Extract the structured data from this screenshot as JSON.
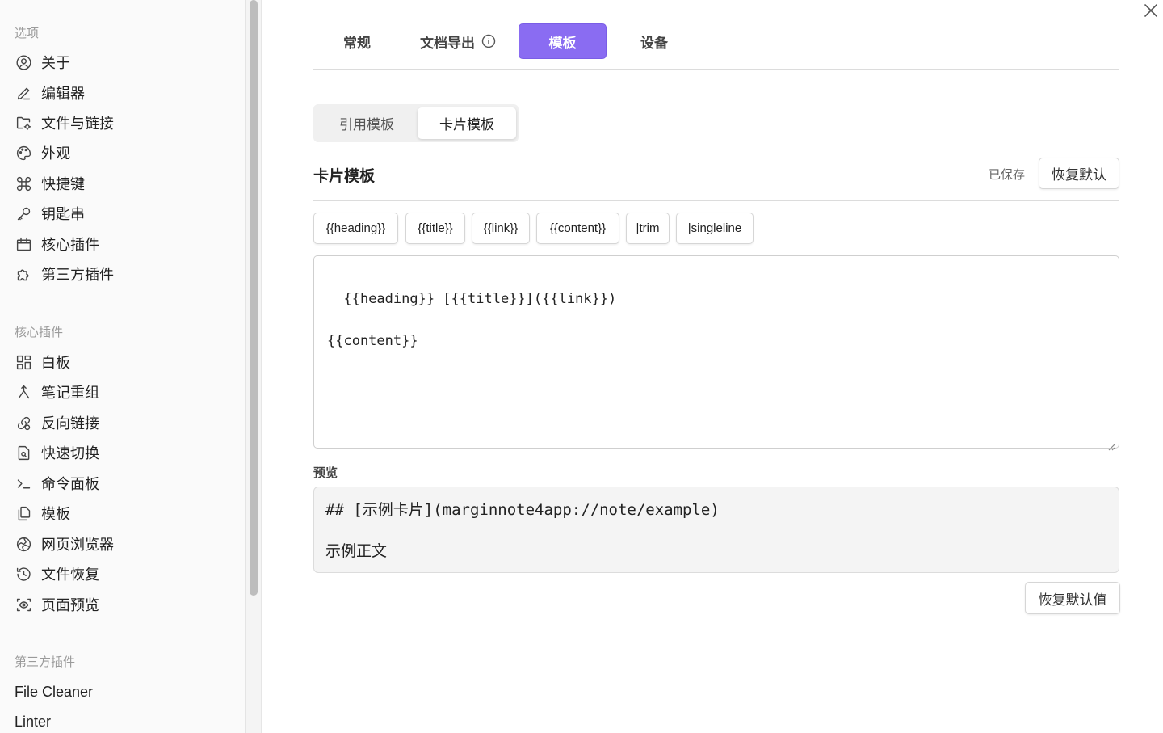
{
  "sidebar": {
    "sections": [
      {
        "title": "选项",
        "items": [
          {
            "label": "关于",
            "icon": "user-circle-icon"
          },
          {
            "label": "编辑器",
            "icon": "pencil-icon"
          },
          {
            "label": "文件与链接",
            "icon": "folder-cog-icon"
          },
          {
            "label": "外观",
            "icon": "palette-icon"
          },
          {
            "label": "快捷键",
            "icon": "command-icon"
          },
          {
            "label": "钥匙串",
            "icon": "key-icon"
          },
          {
            "label": "核心插件",
            "icon": "calendar-box-icon"
          },
          {
            "label": "第三方插件",
            "icon": "puzzle-icon"
          }
        ]
      },
      {
        "title": "核心插件",
        "items": [
          {
            "label": "白板",
            "icon": "layout-dashboard-icon"
          },
          {
            "label": "笔记重组",
            "icon": "merge-icon"
          },
          {
            "label": "反向链接",
            "icon": "link-refresh-icon"
          },
          {
            "label": "快速切换",
            "icon": "file-search-icon"
          },
          {
            "label": "命令面板",
            "icon": "terminal-icon"
          },
          {
            "label": "模板",
            "icon": "files-icon"
          },
          {
            "label": "网页浏览器",
            "icon": "globe-icon"
          },
          {
            "label": "文件恢复",
            "icon": "history-icon"
          },
          {
            "label": "页面预览",
            "icon": "eye-scan-icon"
          }
        ]
      },
      {
        "title": "第三方插件",
        "items": [
          {
            "label": "File Cleaner"
          },
          {
            "label": "Linter"
          }
        ]
      }
    ]
  },
  "tabs": {
    "items": [
      "常规",
      "文档导出",
      "模板",
      "设备"
    ],
    "active": "模板"
  },
  "subtabs": {
    "items": [
      "引用模板",
      "卡片模板"
    ],
    "active": "卡片模板"
  },
  "card_template": {
    "heading": "卡片模板",
    "saved_status": "已保存",
    "reset_button": "恢复默认",
    "chips": [
      "{{heading}}",
      "{{title}}",
      "{{link}}",
      "{{content}}",
      "|trim",
      "|singleline"
    ],
    "editor_value": "{{heading}} [{{title}}]({{link}})\n\n{{content}}",
    "preview_label": "预览",
    "preview_line1": "## [示例卡片](marginnote4app://note/example)",
    "preview_line2": "示例正文",
    "reset_default_value_button": "恢复默认值"
  },
  "colors": {
    "accent": "#8a6cf2",
    "sidebar_bg": "#fafafa",
    "preview_bg": "#f4f4f4"
  }
}
